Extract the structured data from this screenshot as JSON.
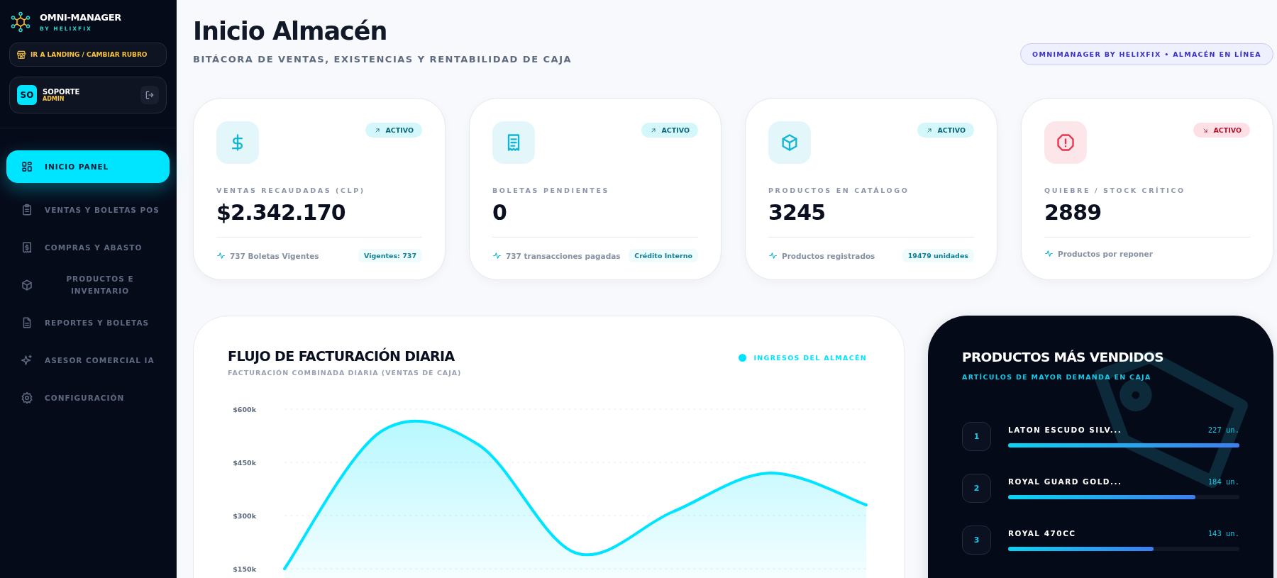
{
  "brand": {
    "name": "OMNI-MANAGER",
    "tagline": "BY HELIXFIX"
  },
  "landing_button": {
    "label": "IR A LANDING / CAMBIAR RUBRO"
  },
  "user": {
    "initials": "SO",
    "name": "SOPORTE",
    "role": "ADMIN"
  },
  "nav": [
    {
      "label": "INICIO PANEL",
      "selected": true
    },
    {
      "label": "VENTAS Y BOLETAS POS",
      "selected": false
    },
    {
      "label": "COMPRAS Y ABASTO",
      "selected": false
    },
    {
      "label": "PRODUCTOS E INVENTARIO",
      "selected": false
    },
    {
      "label": "REPORTES Y BOLETAS",
      "selected": false
    },
    {
      "label": "ASESOR COMERCIAL IA",
      "selected": false
    },
    {
      "label": "CONFIGURACIÓN",
      "selected": false
    }
  ],
  "page": {
    "title": "Inicio Almacén",
    "subtitle": "BITÁCORA DE VENTAS, EXISTENCIAS Y RENTABILIDAD DE CAJA",
    "status_badge": "OMNIMANAGER BY HELIXFIX • ALMACÉN EN LÍNEA"
  },
  "stats": [
    {
      "alert": false,
      "rising": true,
      "badge": "ACTIVO",
      "label": "VENTAS RECAUDADAS (CLP)",
      "value": "$2.342.170",
      "footer": "737 Boletas Vigentes",
      "tag": "Vigentes: 737"
    },
    {
      "alert": false,
      "rising": true,
      "badge": "ACTIVO",
      "label": "BOLETAS PENDIENTES",
      "value": "0",
      "footer": "737 transacciones pagadas",
      "tag": "Crédito Interno"
    },
    {
      "alert": false,
      "rising": true,
      "badge": "ACTIVO",
      "label": "PRODUCTOS EN CATÁLOGO",
      "value": "3245",
      "footer": "Productos registrados",
      "tag": "19479 unidades"
    },
    {
      "alert": true,
      "rising": false,
      "badge": "ACTIVO",
      "label": "QUIEBRE / STOCK CRÍTICO",
      "value": "2889",
      "footer": "Productos por reponer"
    }
  ],
  "revenue_chart": {
    "subtitle": "FACTURACIÓN COMBINADA DIARIA (VENTAS DE CAJA)",
    "chart_data": {
      "type": "area",
      "title": "FLUJO DE FACTURACIÓN DIARIA",
      "series": [
        {
          "name": "INGRESOS DEL ALMACÉN",
          "color": "#00e5ff",
          "values": [
            150000,
            538000,
            500000,
            195000,
            310000,
            420000,
            330000
          ]
        }
      ],
      "ylim": [
        150000,
        600000
      ],
      "yticks": [
        {
          "value": 150000,
          "label": "$150k"
        },
        {
          "value": 300000,
          "label": "$300k"
        },
        {
          "value": 450000,
          "label": "$450k"
        },
        {
          "value": 600000,
          "label": "$600k"
        }
      ]
    }
  },
  "top_products": {
    "title": "PRODUCTOS MÁS VENDIDOS",
    "subtitle": "ARTÍCULOS DE MAYOR DEMANDA EN CAJA",
    "items": [
      {
        "rank": "1",
        "name": "LATON ESCUDO SILV...",
        "count": "227 un.",
        "level": 1.0
      },
      {
        "rank": "2",
        "name": "ROYAL GUARD GOLD...",
        "count": "184 un.",
        "level": 0.81
      },
      {
        "rank": "3",
        "name": "ROYAL 470CC",
        "count": "143 un.",
        "level": 0.63
      }
    ]
  }
}
